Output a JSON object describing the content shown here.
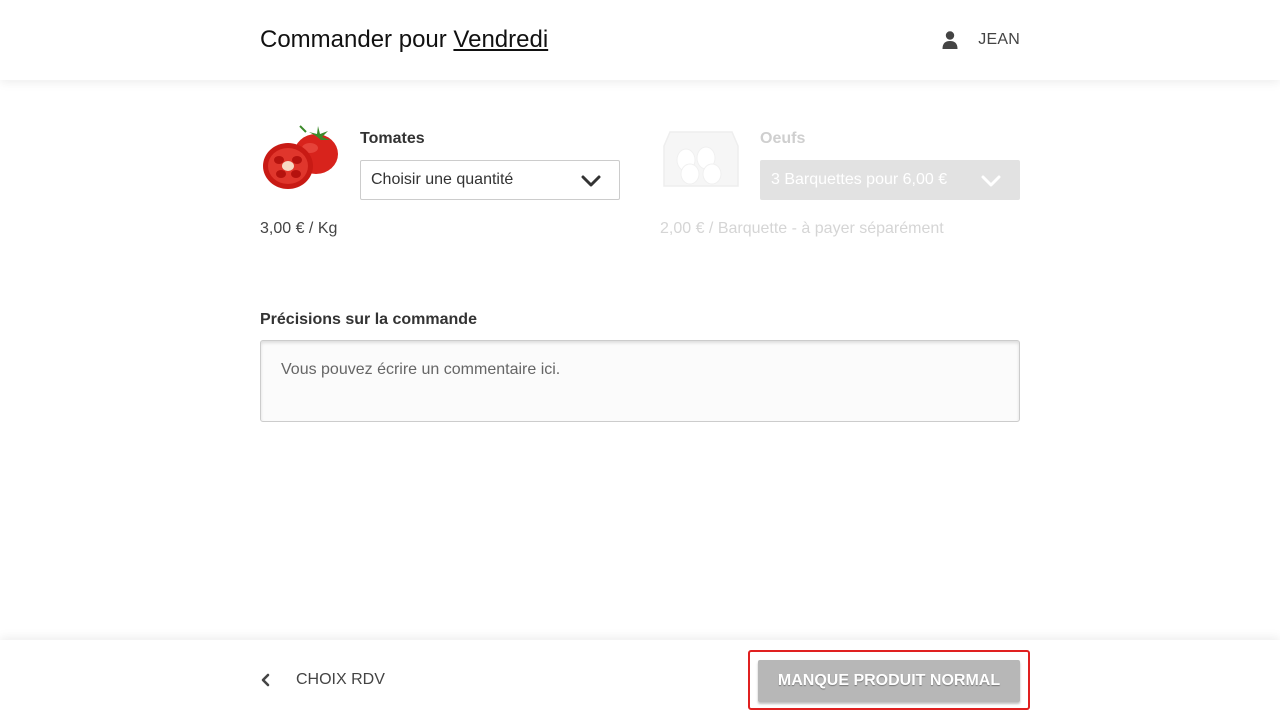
{
  "header": {
    "title_prefix": "Commander pour",
    "title_day": "Vendredi",
    "user_icon": "user-icon",
    "user_name": "JEAN"
  },
  "products": [
    {
      "name": "Tomates",
      "image": "tomato-image",
      "quantity_value": "Choisir une quantité",
      "price": "3,00 € / Kg",
      "disabled": false
    },
    {
      "name": "Oeufs",
      "image": "egg-carton-image",
      "quantity_value": "3 Barquettes pour 6,00 €",
      "price": "2,00 € / Barquette - à payer séparément",
      "disabled": true
    }
  ],
  "notes": {
    "label": "Précisions sur la commande",
    "placeholder": "Vous pouvez écrire un commentaire ici."
  },
  "footer": {
    "back_icon": "chevron-left-icon",
    "back_label": "CHOIX RDV",
    "submit_label": "MANQUE PRODUIT NORMAL",
    "highlight_color": "#e02020"
  }
}
